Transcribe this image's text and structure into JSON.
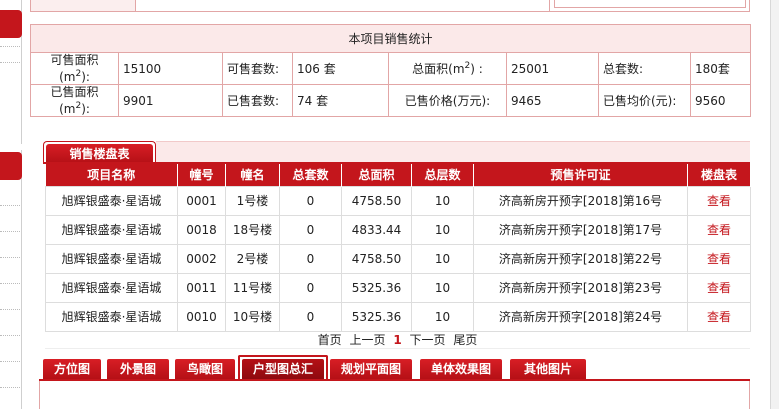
{
  "stats": {
    "title": "本项目销售统计",
    "row1": {
      "saleable_area_label": "可售面积",
      "saleable_area_unit_prefix": "(m",
      "saleable_area_unit_sup": "2",
      "saleable_area_unit_suffix": "):",
      "saleable_area": "15100",
      "saleable_units_label": "可售套数:",
      "saleable_units": "106 套",
      "total_area_label": "总面积(m",
      "total_area_sup": "2",
      "total_area_suffix": ") :",
      "total_area": "25001",
      "total_units_label": "总套数:",
      "total_units": "180套"
    },
    "row2": {
      "sold_area_label": "已售面积",
      "sold_area_unit_prefix": "(m",
      "sold_area_unit_sup": "2",
      "sold_area_unit_suffix": "):",
      "sold_area": "9901",
      "sold_units_label": "已售套数:",
      "sold_units": "74 套",
      "sold_price_label": "已售价格(万元):",
      "sold_price": "9465",
      "avg_price_label": "已售均价(元):",
      "avg_price": "9560"
    }
  },
  "sales": {
    "tab_label": "销售楼盘表",
    "headers": [
      "项目名称",
      "幢号",
      "幢名",
      "总套数",
      "总面积",
      "总层数",
      "预售许可证",
      "楼盘表"
    ],
    "rows": [
      [
        "旭辉银盛泰·星语城",
        "0001",
        "1号楼",
        "0",
        "4758.50",
        "10",
        "济高新房开预字[2018]第16号",
        "查看"
      ],
      [
        "旭辉银盛泰·星语城",
        "0018",
        "18号楼",
        "0",
        "4833.44",
        "10",
        "济高新房开预字[2018]第17号",
        "查看"
      ],
      [
        "旭辉银盛泰·星语城",
        "0002",
        "2号楼",
        "0",
        "4758.50",
        "10",
        "济高新房开预字[2018]第22号",
        "查看"
      ],
      [
        "旭辉银盛泰·星语城",
        "0011",
        "11号楼",
        "0",
        "5325.36",
        "10",
        "济高新房开预字[2018]第23号",
        "查看"
      ],
      [
        "旭辉银盛泰·星语城",
        "0010",
        "10号楼",
        "0",
        "5325.36",
        "10",
        "济高新房开预字[2018]第24号",
        "查看"
      ]
    ]
  },
  "pager": {
    "first": "首页",
    "prev": "上一页",
    "current": "1",
    "next": "下一页",
    "last": "尾页"
  },
  "bottom_tabs": [
    {
      "label": "方位图",
      "active": false
    },
    {
      "label": "外景图",
      "active": false
    },
    {
      "label": "鸟瞰图",
      "active": false
    },
    {
      "label": "户型图总汇",
      "active": true
    },
    {
      "label": "规划平面图",
      "active": false
    },
    {
      "label": "单体效果图",
      "active": false
    },
    {
      "label": "其他图片",
      "active": false
    }
  ],
  "colors": {
    "accent_red": "#c4161c",
    "border_pink": "#e2a6a6",
    "header_pink": "#fbe9e9"
  }
}
